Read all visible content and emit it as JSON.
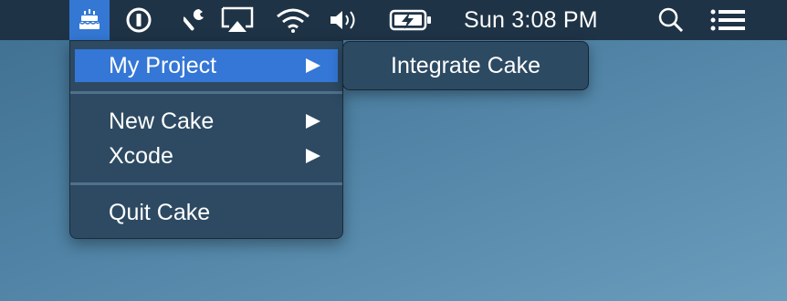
{
  "menubar": {
    "app_icon": "cake-icon",
    "status_icons": [
      "1password-icon",
      "wrench-icon",
      "airplay-icon",
      "wifi-icon",
      "volume-icon",
      "battery-charging-icon",
      "spotlight-search-icon",
      "notification-center-icon"
    ],
    "clock": "Sun 3:08 PM"
  },
  "menu": {
    "items": [
      {
        "label": "My Project",
        "has_submenu": true,
        "highlighted": true
      },
      {
        "label": "New Cake",
        "has_submenu": true
      },
      {
        "label": "Xcode",
        "has_submenu": true
      },
      {
        "label": "Quit Cake",
        "has_submenu": false
      }
    ]
  },
  "submenu": {
    "items": [
      {
        "label": "Integrate Cake"
      }
    ]
  },
  "colors": {
    "menubar_bg": "#1f3346",
    "highlight": "#3477d6",
    "menu_bg": "#2c4860",
    "desktop": "#4f82a4"
  }
}
